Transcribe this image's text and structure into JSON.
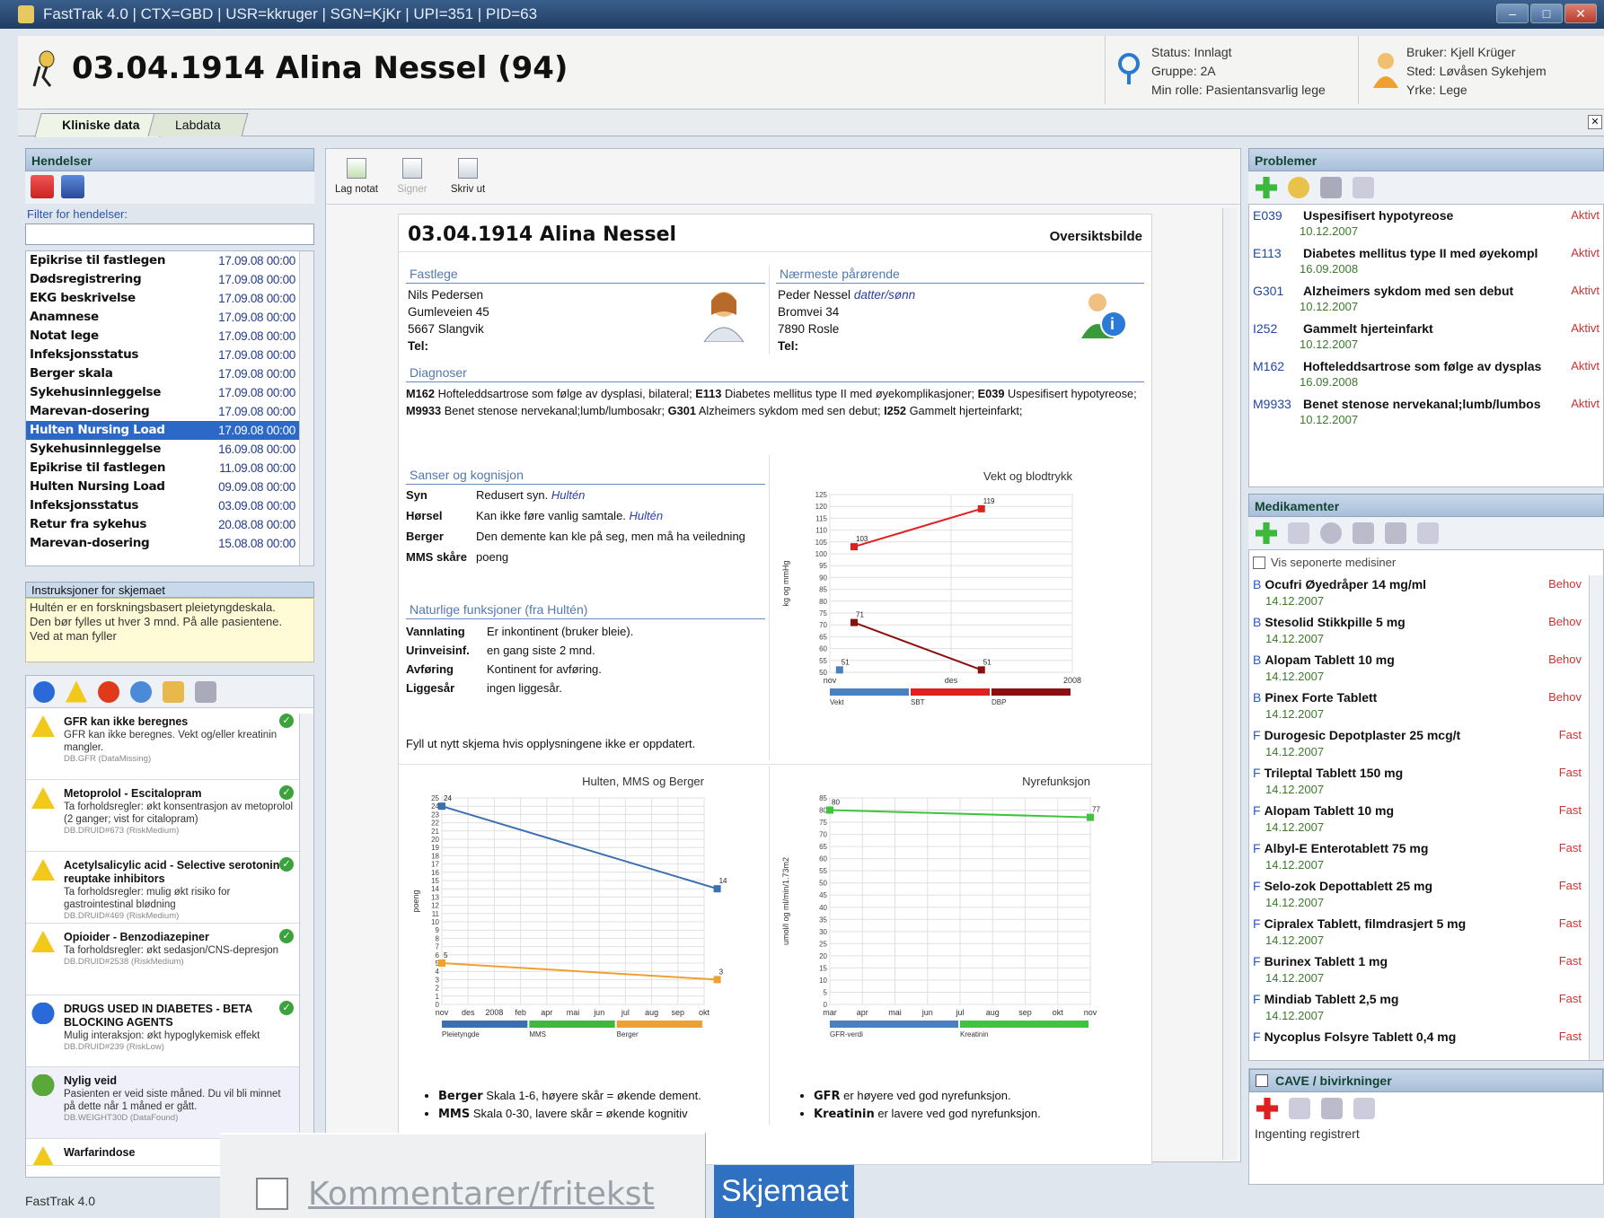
{
  "window": {
    "title": "FastTrak 4.0 | CTX=GBD | USR=kkruger | SGN=KjKr | UPI=351 | PID=63",
    "status_bar": "FastTrak 4.0"
  },
  "patient": {
    "title": "03.04.1914 Alina Nessel (94)"
  },
  "status": {
    "line1": "Status: Innlagt",
    "line2": "Gruppe: 2A",
    "line3": "Min rolle: Pasientansvarlig lege"
  },
  "user": {
    "line1": "Bruker: Kjell Krüger",
    "line2": "Sted: Løvåsen Sykehjem",
    "line3": "Yrke: Lege"
  },
  "tabs": [
    "Kliniske data",
    "Labdata"
  ],
  "hendelser": {
    "title": "Hendelser",
    "filter_label": "Filter for hendelser:",
    "filter_value": "",
    "selected_index": 9,
    "items": [
      {
        "name": "Epikrise til fastlegen",
        "date": "17.09.08 00:00"
      },
      {
        "name": "Dødsregistrering",
        "date": "17.09.08 00:00"
      },
      {
        "name": "EKG beskrivelse",
        "date": "17.09.08 00:00"
      },
      {
        "name": "Anamnese",
        "date": "17.09.08 00:00"
      },
      {
        "name": "Notat lege",
        "date": "17.09.08 00:00"
      },
      {
        "name": "Infeksjonsstatus",
        "date": "17.09.08 00:00"
      },
      {
        "name": "Berger skala",
        "date": "17.09.08 00:00"
      },
      {
        "name": "Sykehusinnleggelse",
        "date": "17.09.08 00:00"
      },
      {
        "name": "Marevan-dosering",
        "date": "17.09.08 00:00"
      },
      {
        "name": "Hulten Nursing Load",
        "date": "17.09.08 00:00"
      },
      {
        "name": "Sykehusinnleggelse",
        "date": "16.09.08 00:00"
      },
      {
        "name": "Epikrise til fastlegen",
        "date": "11.09.08 00:00"
      },
      {
        "name": "Hulten Nursing Load",
        "date": "09.09.08 00:00"
      },
      {
        "name": "Infeksjonsstatus",
        "date": "03.09.08 00:00"
      },
      {
        "name": "Retur fra sykehus",
        "date": "20.08.08 00:00"
      },
      {
        "name": "Marevan-dosering",
        "date": "15.08.08 00:00"
      }
    ]
  },
  "instruks": {
    "title": "Instruksjoner for skjemaet",
    "text": "Hultén er en forskningsbasert pleietyngdeskala. Den bør fylles ut hver 3 mnd. På alle pasientene. Ved at man fyller"
  },
  "alerts": [
    {
      "title": "GFR kan ikke beregnes",
      "text": "GFR kan ikke beregnes. Vekt og/eller kreatinin mangler.",
      "source": "DB.GFR (DataMissing)",
      "icon": "warning-icon"
    },
    {
      "title": "Metoprolol - Escitalopram",
      "text": "Ta forholdsregler: økt konsentrasjon av metoprolol (2 ganger; vist for citalopram)",
      "source": "DB.DRUID#673 (RiskMedium)",
      "icon": "warning-icon"
    },
    {
      "title": "Acetylsalicylic acid - Selective serotonin reuptake inhibitors",
      "text": "Ta forholdsregler: mulig økt risiko for gastrointestinal blødning",
      "source": "DB.DRUID#469 (RiskMedium)",
      "icon": "warning-icon"
    },
    {
      "title": "Opioider - Benzodiazepiner",
      "text": "Ta forholdsregler: økt sedasjon/CNS-depresjon",
      "source": "DB.DRUID#2538 (RiskMedium)",
      "icon": "warning-icon"
    },
    {
      "title": "DRUGS USED IN DIABETES - BETA BLOCKING AGENTS",
      "text": "Mulig interaksjon: økt hypoglykemisk effekt",
      "source": "DB.DRUID#239 (RiskLow)",
      "icon": "info-icon"
    },
    {
      "title": "Nylig veid",
      "text": "Pasienten er veid siste måned. Du vil bli minnet på dette når 1 måned er gått.",
      "source": "DB.WEIGHT30D (DataFound)",
      "icon": "scale-icon"
    },
    {
      "title": "Warfarindose",
      "text": "",
      "source": "",
      "icon": "warning-icon"
    }
  ],
  "toolbar": {
    "lag_notat": "Lag notat",
    "signer": "Signer",
    "skriv_ut": "Skriv ut"
  },
  "doc": {
    "title": "03.04.1914 Alina Nessel",
    "view": "Oversiktsbilde",
    "fastlege": {
      "label": "Fastlege",
      "name": "Nils Pedersen",
      "addr1": "Gumleveien 45",
      "addr2": "5667 Slangvik",
      "tel": "Tel:"
    },
    "parorende": {
      "label": "Nærmeste pårørende",
      "name": "Peder Nessel",
      "rel": "datter/sønn",
      "addr1": "Bromvei 34",
      "addr2": "7890 Rosle",
      "tel": "Tel:"
    },
    "diagnoser": {
      "label": "Diagnoser",
      "parts": [
        [
          "M162",
          " Hofteleddsartrose som følge av dysplasi, bilateral; "
        ],
        [
          "E113",
          " Diabetes mellitus type II med øyekomplikasjoner; "
        ],
        [
          "E039",
          " Uspesifisert hypotyreose; "
        ],
        [
          "M9933",
          " Benet stenose nervekanal;lumb/lumbosakr; "
        ],
        [
          "G301",
          " Alzheimers sykdom med sen debut; "
        ],
        [
          "I252",
          " Gammelt hjerteinfarkt;"
        ]
      ]
    },
    "sanser": {
      "label": "Sanser og kognisjon",
      "rows": [
        {
          "k": "Syn",
          "v": "Redusert syn.",
          "src": "Hultén"
        },
        {
          "k": "Hørsel",
          "v": "Kan ikke føre vanlig samtale.",
          "src": "Hultén"
        },
        {
          "k": "Berger",
          "v": "Den demente kan kle på seg, men må ha veiledning",
          "src": ""
        },
        {
          "k": "MMS skåre",
          "v": "poeng",
          "src": ""
        }
      ]
    },
    "naturlige": {
      "label": "Naturlige funksjoner (fra Hultén)",
      "rows": [
        {
          "k": "Vannlating",
          "v": "Er inkontinent (bruker bleie)."
        },
        {
          "k": "Urinveisinf.",
          "v": "en gang siste 2 mnd."
        },
        {
          "k": "Avføring",
          "v": "Kontinent for avføring."
        },
        {
          "k": "Liggesår",
          "v": "ingen liggesår."
        }
      ]
    },
    "footer_note": "Fyll ut nytt skjema hvis opplysningene ikke er oppdatert.",
    "bullets_left": [
      {
        "b": "Berger",
        "t": " Skala 1-6, høyere skår = økende dement."
      },
      {
        "b": "MMS",
        "t": " Skala 0-30, lavere skår = økende kognitiv"
      }
    ],
    "bullets_right": [
      {
        "b": "GFR",
        "t": " er høyere ved god nyrefunksjon."
      },
      {
        "b": "Kreatinin",
        "t": " er lavere ved god nyrefunksjon."
      }
    ]
  },
  "chart_data": [
    {
      "type": "line",
      "title": "Vekt og blodtrykk",
      "ylabel": "kg og mmHg",
      "ylim": [
        50,
        125
      ],
      "x_ticks": [
        "nov",
        "des",
        "2008"
      ],
      "series": [
        {
          "name": "Vekt",
          "color": "#4a7fc0",
          "points": [
            [
              0.08,
              51
            ]
          ]
        },
        {
          "name": "SBT",
          "color": "#e02020",
          "points": [
            [
              0.2,
              103
            ],
            [
              1.25,
              119
            ]
          ]
        },
        {
          "name": "DBP",
          "color": "#8a1010",
          "points": [
            [
              0.2,
              71
            ],
            [
              1.25,
              51
            ]
          ]
        }
      ]
    },
    {
      "type": "line",
      "title": "Hulten, MMS og Berger",
      "ylabel": "poeng",
      "ylim": [
        0,
        25
      ],
      "x_ticks": [
        "nov",
        "des",
        "2008",
        "feb",
        "apr",
        "mai",
        "jun",
        "jul",
        "aug",
        "sep",
        "okt"
      ],
      "series": [
        {
          "name": "Pleietyngde",
          "color": "#3b6fb0",
          "points": [
            [
              0,
              24
            ],
            [
              10.5,
              14
            ]
          ]
        },
        {
          "name": "MMS",
          "color": "#3fb83f",
          "points": []
        },
        {
          "name": "Berger",
          "color": "#f0a030",
          "points": [
            [
              0,
              5
            ],
            [
              10.5,
              3
            ]
          ]
        }
      ]
    },
    {
      "type": "line",
      "title": "Nyrefunksjon",
      "ylabel": "umol/l og ml/min/1.73m2",
      "ylim": [
        0,
        85
      ],
      "x_ticks": [
        "mar",
        "apr",
        "mai",
        "jun",
        "jul",
        "aug",
        "sep",
        "okt",
        "nov"
      ],
      "series": [
        {
          "name": "GFR-verdi",
          "color": "#4a7fc0",
          "points": []
        },
        {
          "name": "Kreatinin",
          "color": "#3fc43f",
          "points": [
            [
              0,
              80
            ],
            [
              8,
              77
            ]
          ]
        }
      ]
    }
  ],
  "problemer": {
    "title": "Problemer",
    "items": [
      {
        "code": "E039",
        "name": "Uspesifisert hypotyreose",
        "date": "10.12.2007",
        "status": "Aktivt"
      },
      {
        "code": "E113",
        "name": "Diabetes mellitus type II med øyekompl",
        "date": "16.09.2008",
        "status": "Aktivt"
      },
      {
        "code": "G301",
        "name": "Alzheimers sykdom med sen debut",
        "date": "10.12.2007",
        "status": "Aktivt"
      },
      {
        "code": "I252",
        "name": "Gammelt hjerteinfarkt",
        "date": "10.12.2007",
        "status": "Aktivt"
      },
      {
        "code": "M162",
        "name": "Hofteleddsartrose som følge av dysplas",
        "date": "16.09.2008",
        "status": "Aktivt"
      },
      {
        "code": "M9933",
        "name": "Benet stenose nervekanal;lumb/lumbos",
        "date": "10.12.2007",
        "status": "Aktivt"
      }
    ]
  },
  "medikamenter": {
    "title": "Medikamenter",
    "show_label": "Vis seponerte medisiner",
    "items": [
      {
        "k": "B",
        "name": "Ocufri Øyedråper 14 mg/ml",
        "date": "14.12.2007",
        "type": "Behov"
      },
      {
        "k": "B",
        "name": "Stesolid Stikkpille 5 mg",
        "date": "14.12.2007",
        "type": "Behov"
      },
      {
        "k": "B",
        "name": "Alopam Tablett 10 mg",
        "date": "14.12.2007",
        "type": "Behov"
      },
      {
        "k": "B",
        "name": "Pinex Forte Tablett",
        "date": "14.12.2007",
        "type": "Behov"
      },
      {
        "k": "F",
        "name": "Durogesic Depotplaster 25 mcg/t",
        "date": "14.12.2007",
        "type": "Fast"
      },
      {
        "k": "F",
        "name": "Trileptal Tablett 150 mg",
        "date": "14.12.2007",
        "type": "Fast"
      },
      {
        "k": "F",
        "name": "Alopam Tablett 10 mg",
        "date": "14.12.2007",
        "type": "Fast"
      },
      {
        "k": "F",
        "name": "Albyl-E Enterotablett 75 mg",
        "date": "14.12.2007",
        "type": "Fast"
      },
      {
        "k": "F",
        "name": "Selo-zok Depottablett 25 mg",
        "date": "14.12.2007",
        "type": "Fast"
      },
      {
        "k": "F",
        "name": "Cipralex Tablett, filmdrasjert 5 mg",
        "date": "14.12.2007",
        "type": "Fast"
      },
      {
        "k": "F",
        "name": "Burinex Tablett 1 mg",
        "date": "14.12.2007",
        "type": "Fast"
      },
      {
        "k": "F",
        "name": "Mindiab Tablett 2,5 mg",
        "date": "14.12.2007",
        "type": "Fast"
      },
      {
        "k": "F",
        "name": "Nycoplus Folsyre Tablett 0,4 mg",
        "date": "",
        "type": "Fast"
      }
    ]
  },
  "cave": {
    "title": "CAVE / bivirkninger",
    "text": "Ingenting registrert"
  },
  "overlay": {
    "kommentarer": "Kommentarer/fritekst",
    "skjemaet": "Skjemaet"
  }
}
